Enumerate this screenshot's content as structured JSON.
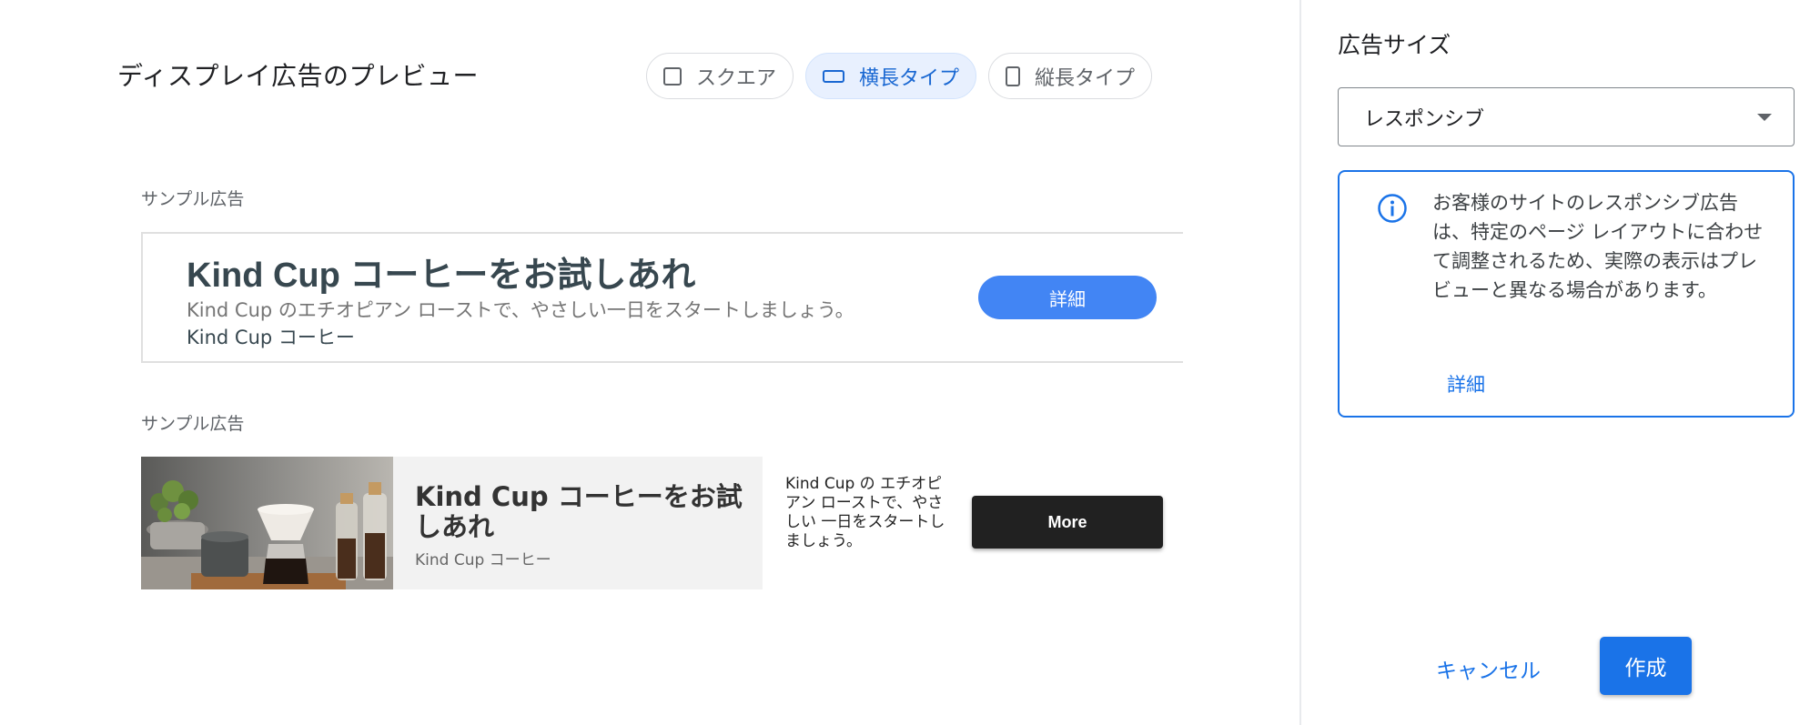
{
  "preview": {
    "title": "ディスプレイ広告のプレビュー",
    "formats": [
      {
        "label": "スクエア",
        "icon": "square-icon",
        "selected": false
      },
      {
        "label": "横長タイプ",
        "icon": "landscape-icon",
        "selected": true
      },
      {
        "label": "縦長タイプ",
        "icon": "portrait-icon",
        "selected": false
      }
    ],
    "ad1": {
      "label": "サンプル広告",
      "headline": "Kind Cup コーヒーをお試しあれ",
      "description": "Kind Cup のエチオピアン ローストで、やさしい一日をスタートしましょう。",
      "business": "Kind Cup コーヒー",
      "button": "詳細"
    },
    "ad2": {
      "label": "サンプル広告",
      "headline": "Kind Cup コーヒーをお試しあれ",
      "business": "Kind Cup コーヒー",
      "description": "Kind Cup の エチオピアン ローストで、やさしい 一日をスタートしましょう。",
      "button": "More"
    }
  },
  "settings": {
    "title": "広告サイズ",
    "size_select": "レスポンシブ",
    "info_text": "お客様のサイトのレスポンシブ広告は、特定のページ レイアウトに合わせて調整されるため、実際の表示はプレビューと異なる場合があります。",
    "info_link": "詳細",
    "cancel": "キャンセル",
    "create": "作成"
  },
  "colors": {
    "accent": "#1a73e8",
    "ad_button": "#4285f4",
    "selected_chip_bg": "#e8f0fe"
  }
}
